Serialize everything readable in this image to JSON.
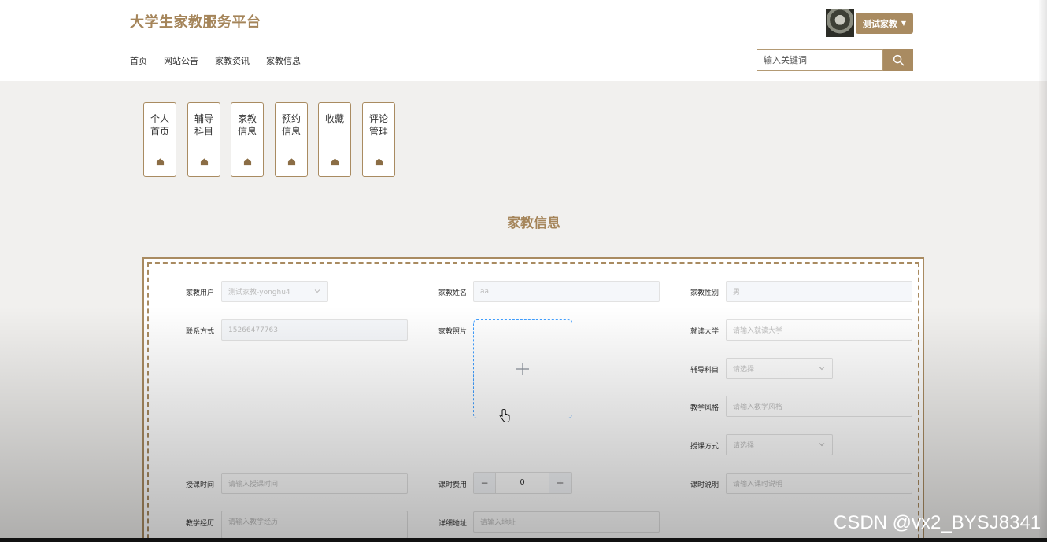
{
  "header": {
    "site_title": "大学生家教服务平台",
    "user_button": "测试家教",
    "search": {
      "placeholder": "输入关键词",
      "value": ""
    },
    "nav": [
      "首页",
      "网站公告",
      "家教资讯",
      "家教信息"
    ]
  },
  "side_tabs": [
    {
      "label": "个人首页"
    },
    {
      "label": "辅导科目"
    },
    {
      "label": "家教信息"
    },
    {
      "label": "预约信息"
    },
    {
      "label": "收藏"
    },
    {
      "label": "评论管理"
    }
  ],
  "page_title": "家教信息",
  "form": {
    "tutor_user": {
      "label": "家教用户",
      "value": "测试家教-yonghu4"
    },
    "tutor_name": {
      "label": "家教姓名",
      "value": "aa"
    },
    "tutor_gender": {
      "label": "家教性别",
      "value": "男"
    },
    "contact": {
      "label": "联系方式",
      "value": "15266477763"
    },
    "photo": {
      "label": "家教照片"
    },
    "university": {
      "label": "就读大学",
      "placeholder": "请输入就读大学"
    },
    "subject": {
      "label": "辅导科目",
      "placeholder": "请选择"
    },
    "style": {
      "label": "教学风格",
      "placeholder": "请输入教学风格"
    },
    "method": {
      "label": "授课方式",
      "placeholder": "请选择"
    },
    "time": {
      "label": "授课时间",
      "placeholder": "请输入授课时间"
    },
    "fee": {
      "label": "课时费用",
      "value": "0",
      "minus": "−",
      "plus": "+"
    },
    "fee_note": {
      "label": "课时说明",
      "placeholder": "请输入课时说明"
    },
    "experience": {
      "label": "教学经历",
      "placeholder": "请输入教学经历"
    },
    "address": {
      "label": "详细地址",
      "placeholder": "请输入地址"
    }
  },
  "watermark": "CSDN @vx2_BYSJ8341",
  "colors": {
    "accent": "#a98b61",
    "title": "#a5855a",
    "upload_border": "#409eff"
  }
}
